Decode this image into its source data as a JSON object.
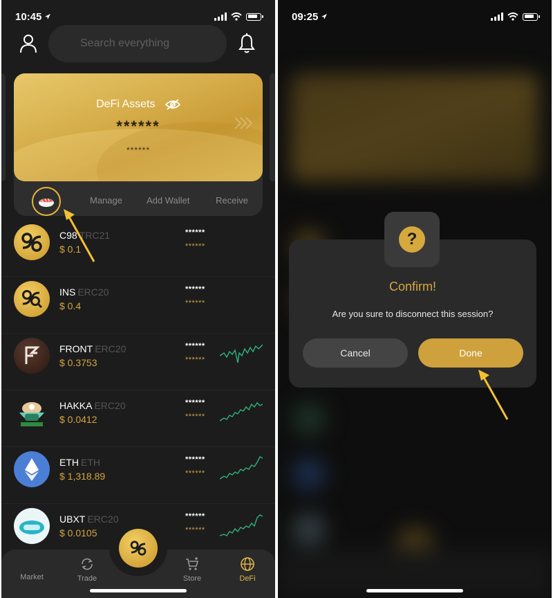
{
  "left": {
    "status": {
      "time": "10:45"
    },
    "search": {
      "placeholder": "Search everything"
    },
    "card": {
      "title": "DeFi Assets",
      "balance_mask": "******",
      "sub_mask": "******"
    },
    "actions": {
      "manage": "Manage",
      "add_wallet": "Add Wallet",
      "receive": "Receive"
    },
    "tokens": [
      {
        "symbol": "C98",
        "standard": "TRC21",
        "price": "$ 0.1",
        "bal1": "******",
        "bal2": "******",
        "has_chart": false
      },
      {
        "symbol": "INS",
        "standard": "ERC20",
        "price": "$ 0.4",
        "bal1": "******",
        "bal2": "******",
        "has_chart": false
      },
      {
        "symbol": "FRONT",
        "standard": "ERC20",
        "price": "$ 0.3753",
        "bal1": "******",
        "bal2": "******",
        "has_chart": true
      },
      {
        "symbol": "HAKKA",
        "standard": "ERC20",
        "price": "$ 0.0412",
        "bal1": "******",
        "bal2": "******",
        "has_chart": true
      },
      {
        "symbol": "ETH",
        "standard": "ETH",
        "price": "$ 1,318.89",
        "bal1": "******",
        "bal2": "******",
        "has_chart": true
      },
      {
        "symbol": "UBXT",
        "standard": "ERC20",
        "price": "$ 0.0105",
        "bal1": "******",
        "bal2": "******",
        "has_chart": true
      }
    ],
    "tabs": {
      "market": "Market",
      "trade": "Trade",
      "store": "Store",
      "defi": "DeFi"
    }
  },
  "right": {
    "status": {
      "time": "09:25"
    },
    "dialog": {
      "title": "Confirm!",
      "message": "Are you sure to disconnect this session?",
      "cancel": "Cancel",
      "done": "Done",
      "icon_glyph": "?"
    }
  },
  "colors": {
    "gold": "#d6a83e",
    "background": "#1c1c1c",
    "annotation_arrow": "#f2c230",
    "spark_green": "#2fb37a"
  }
}
